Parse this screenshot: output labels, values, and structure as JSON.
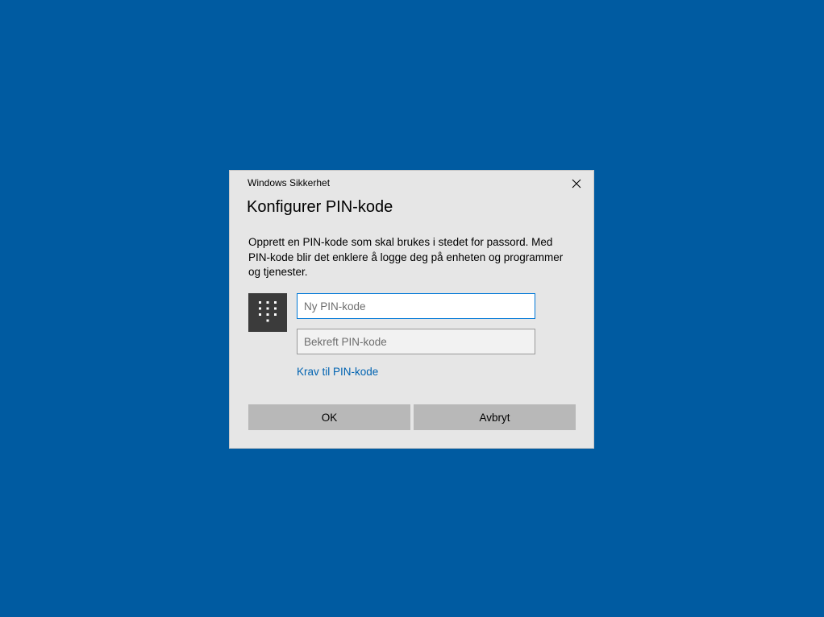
{
  "colors": {
    "desktop_background": "#005ba1",
    "dialog_background": "#e6e6e6",
    "pin_tile_background": "#3b3b3b",
    "link": "#0063b1",
    "button_background": "#b8b8b8",
    "focus_border": "#0078d7"
  },
  "dialog": {
    "caption": "Windows Sikkerhet",
    "close_icon": "close-icon",
    "title": "Konfigurer PIN-kode",
    "description": "Opprett en PIN-kode som skal brukes i stedet for passord. Med PIN-kode blir det enklere å logge deg på enheten og programmer og tjenester.",
    "pin_icon": "keypad-icon",
    "new_pin": {
      "value": "",
      "placeholder": "Ny PIN-kode"
    },
    "confirm_pin": {
      "value": "",
      "placeholder": "Bekreft PIN-kode"
    },
    "requirements_link": "Krav til PIN-kode",
    "ok_label": "OK",
    "cancel_label": "Avbryt"
  }
}
